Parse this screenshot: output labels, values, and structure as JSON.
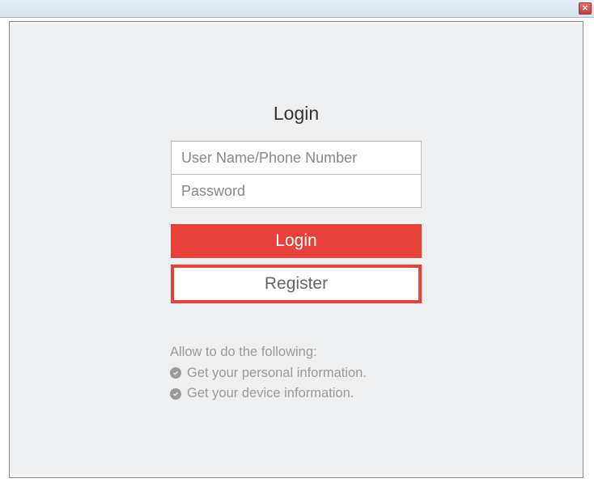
{
  "heading": "Login",
  "inputs": {
    "username_placeholder": "User Name/Phone Number",
    "password_placeholder": "Password"
  },
  "buttons": {
    "login": "Login",
    "register": "Register"
  },
  "permissions": {
    "heading": "Allow to do the following:",
    "items": [
      "Get your personal information.",
      "Get your device information."
    ]
  }
}
